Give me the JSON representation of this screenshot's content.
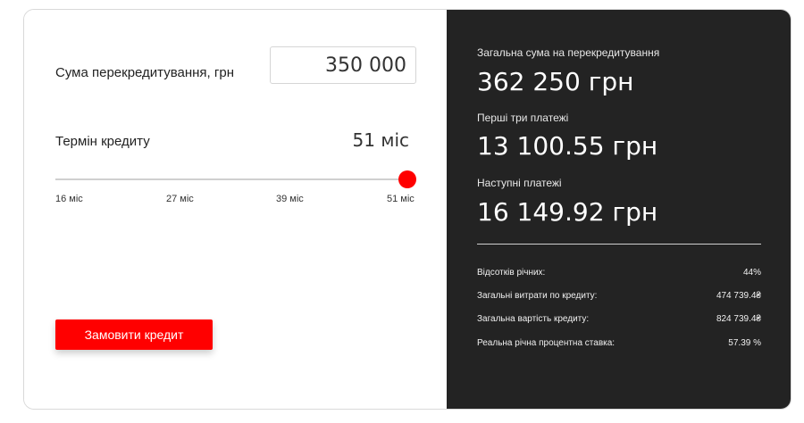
{
  "calculator": {
    "amount_label": "Сума перекредитування, грн",
    "amount_value": "350 000",
    "term_label": "Термін кредиту",
    "term_value": "51 міс",
    "term_slider": {
      "min_months": 16,
      "max_months": 51,
      "value_months": 51
    },
    "ticks": [
      "16 міс",
      "27 міс",
      "39 міс",
      "51 міс"
    ],
    "order_button": "Замовити кредит"
  },
  "summary": {
    "total_label": "Загальна сума на перекредитування",
    "total_value": "362 250 грн",
    "first_label": "Перші три платежі",
    "first_value": "13 100.55 грн",
    "next_label": "Наступні платежі",
    "next_value": "16 149.92 грн",
    "stats": [
      {
        "label": "Відсотків річних:",
        "value": "44%"
      },
      {
        "label": "Загальні витрати по кредиту:",
        "value": "474 739.4₴"
      },
      {
        "label": "Загальна вартість кредиту:",
        "value": "824 739.4₴"
      },
      {
        "label": "Реальна річна процентна ставка:",
        "value": "57.39 %"
      }
    ]
  },
  "colors": {
    "accent": "#ff0000",
    "panel_dark": "#232323"
  }
}
